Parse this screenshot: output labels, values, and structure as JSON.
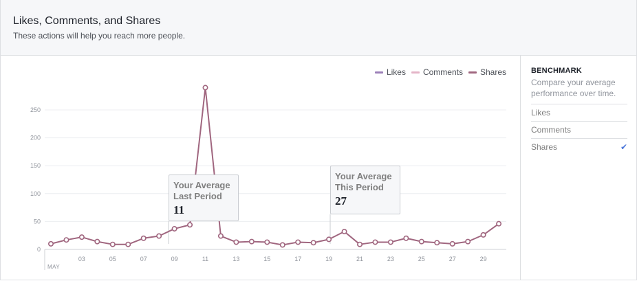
{
  "header": {
    "title": "Likes, Comments, and Shares",
    "subtitle": "These actions will help you reach more people."
  },
  "legend": [
    {
      "label": "Likes",
      "color": "#9b7fb8"
    },
    {
      "label": "Comments",
      "color": "#e4b4c7"
    },
    {
      "label": "Shares",
      "color": "#a0667f"
    }
  ],
  "callouts": {
    "last": {
      "line1": "Your Average",
      "line2": "Last Period",
      "value": "11"
    },
    "this": {
      "line1": "Your Average",
      "line2": "This Period",
      "value": "27"
    }
  },
  "sidebar": {
    "title": "BENCHMARK",
    "description": "Compare your average performance over time.",
    "items": [
      {
        "label": "Likes",
        "selected": false
      },
      {
        "label": "Comments",
        "selected": false
      },
      {
        "label": "Shares",
        "selected": true
      }
    ],
    "check_glyph": "✔"
  },
  "chart_data": {
    "type": "line",
    "x_tick_labels": [
      "03",
      "05",
      "07",
      "09",
      "11",
      "13",
      "15",
      "17",
      "19",
      "21",
      "23",
      "25",
      "27",
      "29"
    ],
    "x_month_label": "MAY",
    "y_ticks": [
      0,
      50,
      100,
      150,
      200,
      250
    ],
    "ylim": [
      0,
      280
    ],
    "grid": true,
    "legend_position": "top-right",
    "series": [
      {
        "name": "Shares",
        "color": "#a0667f",
        "x": [
          1,
          2,
          3,
          4,
          5,
          6,
          7,
          8,
          9,
          10,
          11,
          12,
          13,
          14,
          15,
          16,
          17,
          18,
          19,
          20,
          21,
          22,
          23,
          24,
          25,
          26,
          27,
          28,
          29,
          30
        ],
        "values": [
          10,
          17,
          22,
          14,
          9,
          9,
          20,
          24,
          37,
          44,
          290,
          24,
          13,
          14,
          13,
          8,
          13,
          12,
          18,
          32,
          9,
          13,
          13,
          20,
          14,
          12,
          10,
          14,
          26,
          46
        ]
      }
    ]
  }
}
